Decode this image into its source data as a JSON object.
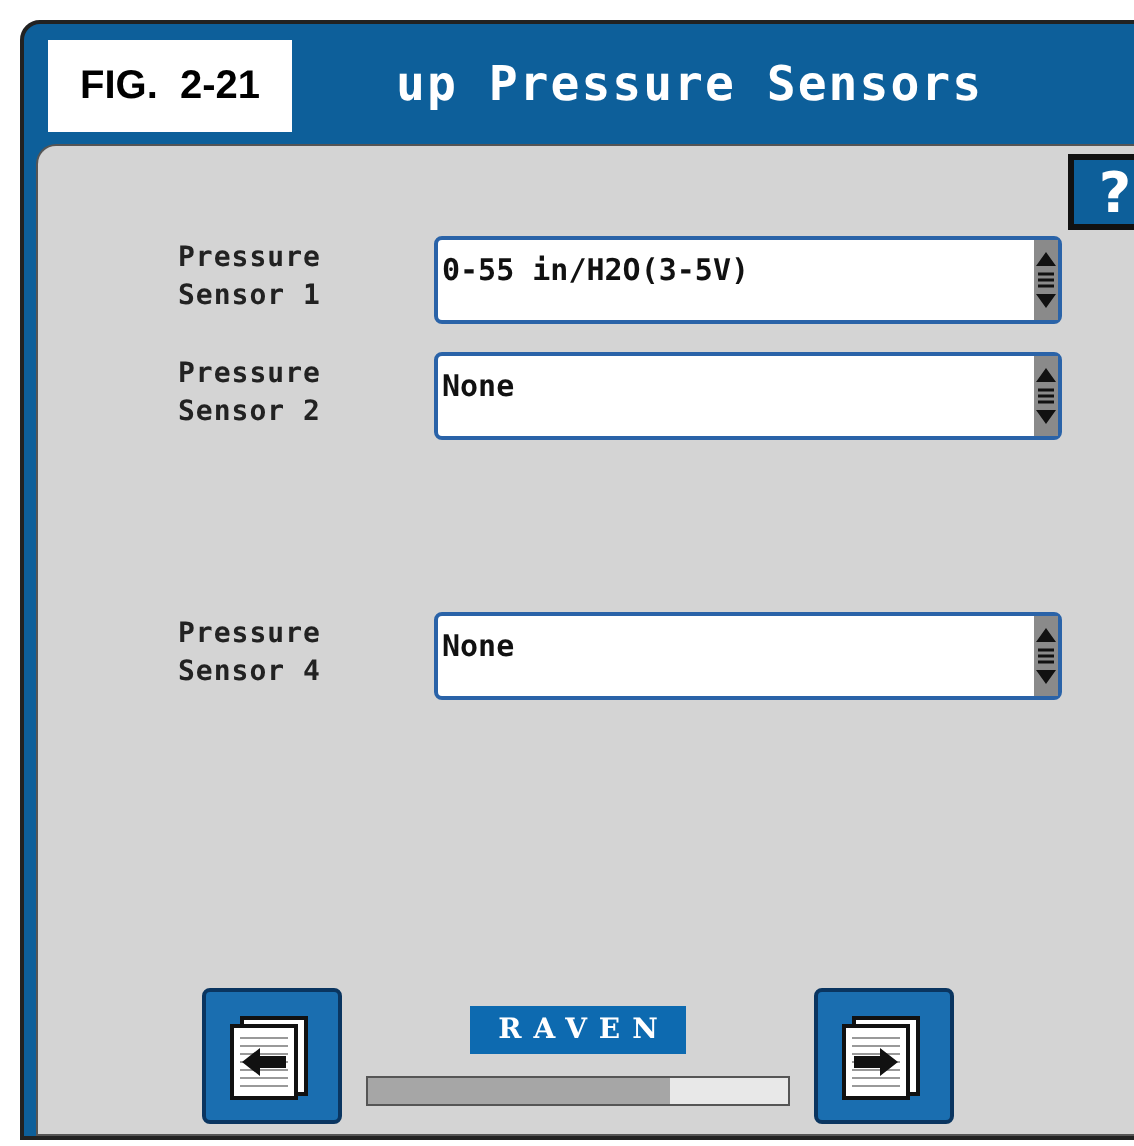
{
  "figure_label": "FIG.  2-21",
  "window": {
    "title": "up Pressure Sensors"
  },
  "help_button": {
    "label": "?"
  },
  "sensors": [
    {
      "label": "Pressure Sensor 1",
      "value": "0-55 in/H2O(3-5V)"
    },
    {
      "label": "Pressure Sensor 2",
      "value": "None"
    },
    {
      "label": "Pressure Sensor 4",
      "value": "None"
    }
  ],
  "footer": {
    "logo": "RAVEN",
    "progress": {
      "level": 0.72
    }
  }
}
